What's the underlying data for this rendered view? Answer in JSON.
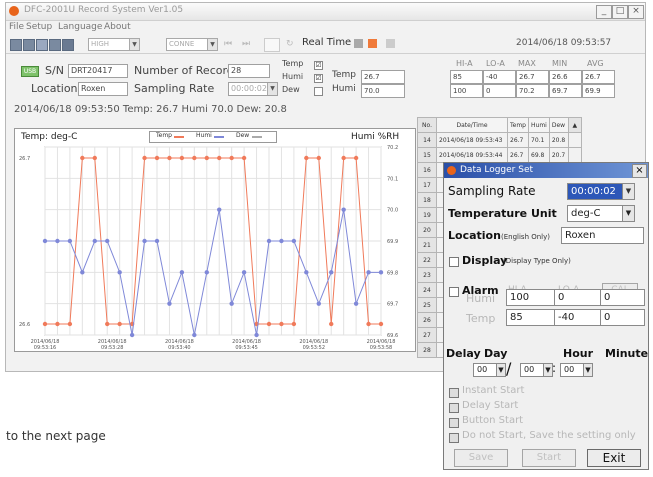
{
  "window": {
    "title": "DFC-2001U Record System Ver1.05",
    "controls": [
      "_",
      "□",
      "×"
    ]
  },
  "menu": [
    "File",
    "Setup",
    "Language",
    "About"
  ],
  "toolbar": {
    "combo1": "HIGH",
    "combo2": "CONNE",
    "real_time_label": "Real Time",
    "datetime": "2014/06/18 09:53:57"
  },
  "device": {
    "badge": "USB",
    "sn_label": "S/N",
    "sn_value": "DRT20417",
    "records_label": "Number of Records",
    "records_value": "28",
    "location_label": "Location",
    "location_value": "Roxen",
    "rate_label": "Sampling Rate",
    "rate_value": "00:00:02",
    "checks": [
      {
        "label": "Temp",
        "checked": "☑"
      },
      {
        "label": "Humi",
        "checked": "☑"
      },
      {
        "label": "Dew",
        "checked": ""
      }
    ]
  },
  "stats": {
    "headers": [
      "HI-A",
      "LO-A",
      "MAX",
      "MIN",
      "AVG"
    ],
    "rows": [
      {
        "label": "Temp",
        "value": "26.7",
        "cells": [
          "85",
          "-40",
          "26.7",
          "26.6",
          "26.7"
        ]
      },
      {
        "label": "Humi",
        "value": "70.0",
        "cells": [
          "100",
          "0",
          "70.2",
          "69.7",
          "69.9"
        ]
      }
    ]
  },
  "status_line": "2014/06/18 09:53:50    Temp: 26.7    Humi 70.0    Dew: 20.8",
  "chart_data": {
    "type": "line",
    "left_axis_title": "Temp: deg-C",
    "right_axis_title": "Humi %RH",
    "legend": [
      "Temp",
      "Humi",
      "Dew"
    ],
    "left_ticks": [
      "26.7",
      "26.6"
    ],
    "right_ticks": [
      "70.2",
      "70.1",
      "70.0",
      "69.9",
      "69.8",
      "69.7",
      "69.6"
    ],
    "x_ticks": [
      "2014/06/18 09:53:16",
      "2014/06/18 09:53:28",
      "2014/06/18 09:53:40",
      "2014/06/18 09:53:45",
      "2014/06/18 09:53:52",
      "2014/06/18 09:53:58"
    ],
    "series": [
      {
        "name": "Temp",
        "color": "#f07a5a",
        "values": [
          26.6,
          26.6,
          26.6,
          26.7,
          26.7,
          26.6,
          26.6,
          26.6,
          26.7,
          26.7,
          26.7,
          26.7,
          26.7,
          26.7,
          26.7,
          26.7,
          26.7,
          26.6,
          26.6,
          26.6,
          26.6,
          26.7,
          26.7,
          26.6,
          26.7,
          26.7,
          26.6,
          26.6
        ]
      },
      {
        "name": "Humi",
        "color": "#7f88d8",
        "values": [
          69.9,
          69.9,
          69.9,
          69.8,
          69.9,
          69.9,
          69.8,
          69.6,
          69.9,
          69.9,
          69.7,
          69.8,
          69.6,
          69.8,
          70.0,
          69.7,
          69.8,
          69.6,
          69.9,
          69.9,
          69.9,
          69.8,
          69.7,
          69.8,
          70.0,
          69.7,
          69.8,
          69.8
        ]
      }
    ]
  },
  "records": {
    "headers": [
      "No.",
      "Date/Time",
      "Temp",
      "Humi",
      "Dew"
    ],
    "rows": [
      {
        "no": "14",
        "dt": "2014/06/18 09:53:43",
        "temp": "26.7",
        "humi": "70.1",
        "dew": "20.8"
      },
      {
        "no": "15",
        "dt": "2014/06/18 09:53:44",
        "temp": "26.7",
        "humi": "69.8",
        "dew": "20.7"
      },
      {
        "no": "16",
        "dt": "",
        "temp": "",
        "humi": "",
        "dew": ""
      },
      {
        "no": "17",
        "dt": "",
        "temp": "",
        "humi": "",
        "dew": ""
      },
      {
        "no": "18",
        "dt": "",
        "temp": "",
        "humi": "",
        "dew": ""
      },
      {
        "no": "19",
        "dt": "",
        "temp": "",
        "humi": "",
        "dew": ""
      },
      {
        "no": "20",
        "dt": "",
        "temp": "",
        "humi": "",
        "dew": ""
      },
      {
        "no": "21",
        "dt": "",
        "temp": "",
        "humi": "",
        "dew": ""
      },
      {
        "no": "22",
        "dt": "",
        "temp": "",
        "humi": "",
        "dew": ""
      },
      {
        "no": "23",
        "dt": "",
        "temp": "",
        "humi": "",
        "dew": ""
      },
      {
        "no": "24",
        "dt": "",
        "temp": "",
        "humi": "",
        "dew": ""
      },
      {
        "no": "25",
        "dt": "",
        "temp": "",
        "humi": "",
        "dew": ""
      },
      {
        "no": "26",
        "dt": "",
        "temp": "",
        "humi": "",
        "dew": ""
      },
      {
        "no": "27",
        "dt": "",
        "temp": "",
        "humi": "",
        "dew": ""
      },
      {
        "no": "28",
        "dt": "",
        "temp": "",
        "humi": "",
        "dew": ""
      }
    ]
  },
  "dialog": {
    "title": "Data Logger Set",
    "sampling_rate_label": "Sampling Rate",
    "sampling_rate_value": "00:00:02",
    "temp_unit_label": "Temperature Unit",
    "temp_unit_value": "deg-C",
    "location_label": "Location",
    "location_hint": "(English Only)",
    "location_value": "Roxen",
    "display_label": "Display",
    "display_hint": "(Display Type Only)",
    "alarm_label": "Alarm",
    "alarm_headers": [
      "HI-A",
      "LO-A",
      "CAL"
    ],
    "alarm_rows": [
      {
        "label": "Humi",
        "hi": "100",
        "lo": "0",
        "cal": "0"
      },
      {
        "label": "Temp",
        "hi": "85",
        "lo": "-40",
        "cal": "0"
      }
    ],
    "delay_label": "Delay",
    "day_label": "Day",
    "hour_label": "Hour",
    "minute_label": "Minute",
    "day_value": "00",
    "hour_value": "00",
    "minute_value": "00",
    "options": [
      "Instant Start",
      "Delay Start",
      "Button Start",
      "Do not Start, Save the setting only"
    ],
    "buttons": {
      "save": "Save",
      "start": "Start",
      "exit": "Exit"
    }
  },
  "page_footer": "to the next page"
}
